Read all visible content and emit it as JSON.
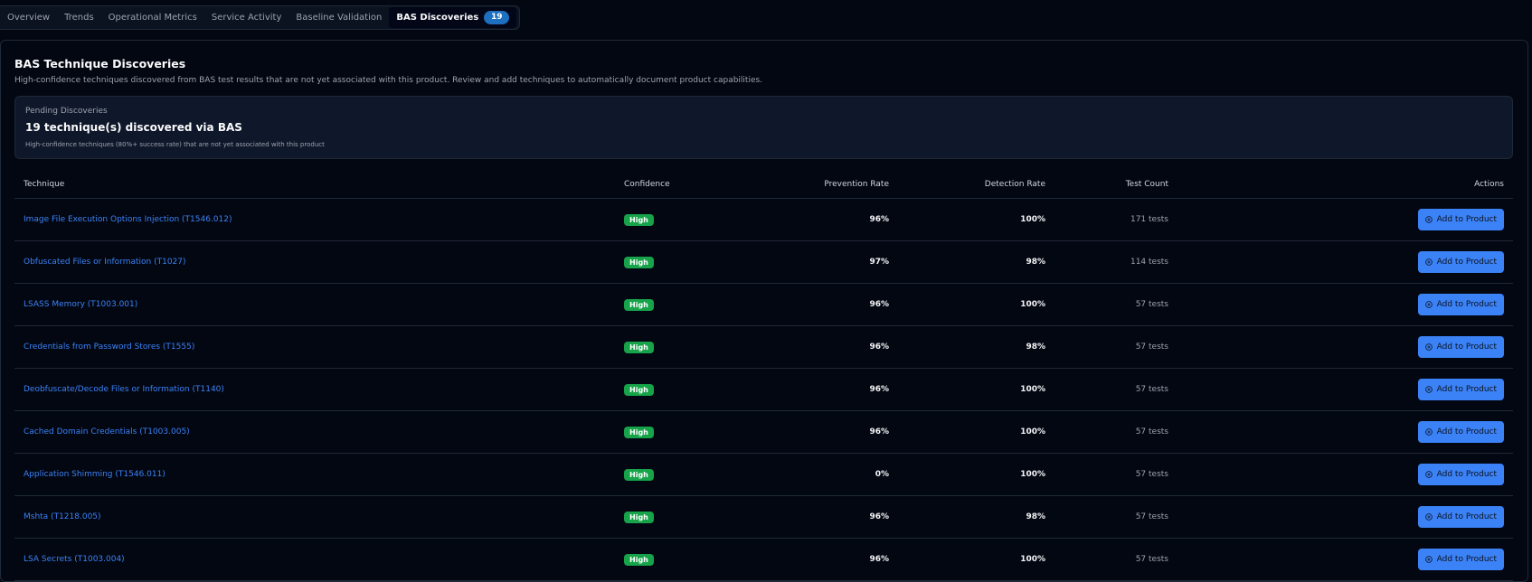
{
  "tabs": [
    {
      "label": "Overview"
    },
    {
      "label": "Trends"
    },
    {
      "label": "Operational Metrics"
    },
    {
      "label": "Service Activity"
    },
    {
      "label": "Baseline Validation"
    },
    {
      "label": "BAS Discoveries",
      "badge": "19",
      "active": true
    }
  ],
  "card": {
    "title": "BAS Technique Discoveries",
    "description": "High-confidence techniques discovered from BAS test results that are not yet associated with this product. Review and add techniques to automatically document product capabilities."
  },
  "pending": {
    "label": "Pending Discoveries",
    "headline": "19 technique(s) discovered via BAS",
    "subtext": "High-confidence techniques (80%+ success rate) that are not yet associated with this product"
  },
  "table": {
    "headers": {
      "technique": "Technique",
      "confidence": "Confidence",
      "prevention": "Prevention Rate",
      "detection": "Detection Rate",
      "count": "Test Count",
      "actions": "Actions"
    },
    "action_label": "Add to Product",
    "rows": [
      {
        "technique": "Image File Execution Options Injection (T1546.012)",
        "confidence": "High",
        "prevention": "96%",
        "detection": "100%",
        "count": "171 tests"
      },
      {
        "technique": "Obfuscated Files or Information (T1027)",
        "confidence": "High",
        "prevention": "97%",
        "detection": "98%",
        "count": "114 tests"
      },
      {
        "technique": "LSASS Memory (T1003.001)",
        "confidence": "High",
        "prevention": "96%",
        "detection": "100%",
        "count": "57 tests"
      },
      {
        "technique": "Credentials from Password Stores (T1555)",
        "confidence": "High",
        "prevention": "96%",
        "detection": "98%",
        "count": "57 tests"
      },
      {
        "technique": "Deobfuscate/Decode Files or Information (T1140)",
        "confidence": "High",
        "prevention": "96%",
        "detection": "100%",
        "count": "57 tests"
      },
      {
        "technique": "Cached Domain Credentials (T1003.005)",
        "confidence": "High",
        "prevention": "96%",
        "detection": "100%",
        "count": "57 tests"
      },
      {
        "technique": "Application Shimming (T1546.011)",
        "confidence": "High",
        "prevention": "0%",
        "detection": "100%",
        "count": "57 tests"
      },
      {
        "technique": "Mshta (T1218.005)",
        "confidence": "High",
        "prevention": "96%",
        "detection": "98%",
        "count": "57 tests"
      },
      {
        "technique": "LSA Secrets (T1003.004)",
        "confidence": "High",
        "prevention": "96%",
        "detection": "100%",
        "count": "57 tests"
      }
    ]
  },
  "colors": {
    "background": "#030712",
    "link": "#3b82f6",
    "confidence_high": "#16a34a",
    "action_button": "#3b82f6",
    "tab_badge": "#1d6fbf"
  },
  "icons": {
    "action": "plus-circle-icon"
  }
}
